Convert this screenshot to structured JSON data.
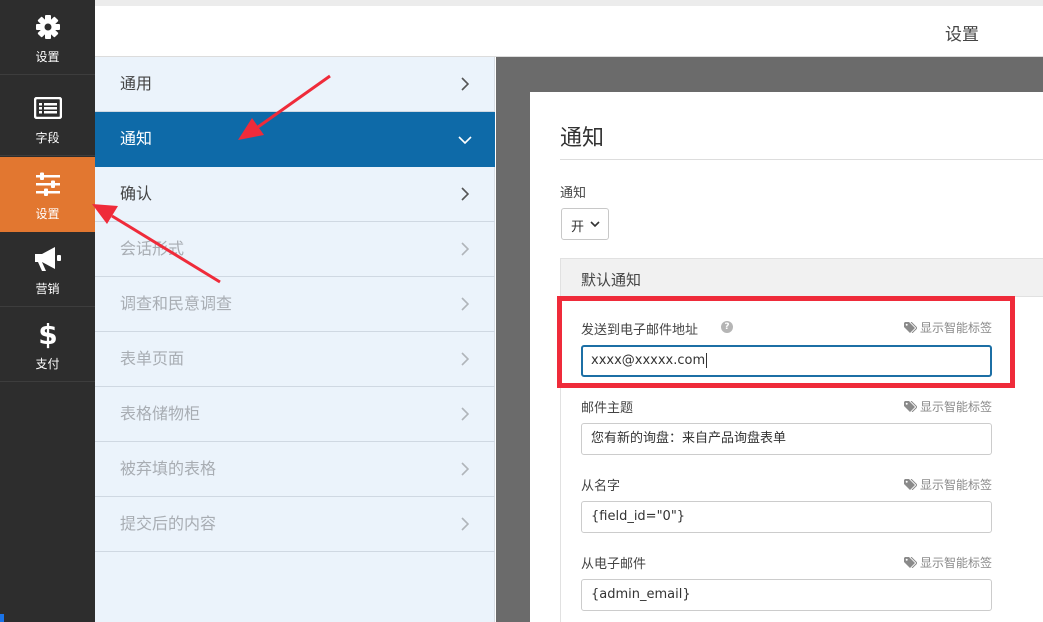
{
  "rail": {
    "items": [
      {
        "label": "设置",
        "icon": "gear-icon",
        "active": false
      },
      {
        "label": "字段",
        "icon": "list-icon",
        "active": false
      },
      {
        "label": "设置",
        "icon": "sliders-icon",
        "active": true
      },
      {
        "label": "营销",
        "icon": "megaphone-icon",
        "active": false
      },
      {
        "label": "支付",
        "icon": "dollar-icon",
        "active": false
      }
    ]
  },
  "header": {
    "title": "设置"
  },
  "menu": {
    "items": [
      {
        "label": "通用",
        "state": "normal"
      },
      {
        "label": "通知",
        "state": "active"
      },
      {
        "label": "确认",
        "state": "normal"
      },
      {
        "label": "会话形式",
        "state": "disabled"
      },
      {
        "label": "调查和民意调查",
        "state": "disabled"
      },
      {
        "label": "表单页面",
        "state": "disabled"
      },
      {
        "label": "表格储物柜",
        "state": "disabled"
      },
      {
        "label": "被弃填的表格",
        "state": "disabled"
      },
      {
        "label": "提交后的内容",
        "state": "disabled"
      }
    ]
  },
  "panel": {
    "title": "通知",
    "notifications_label": "通知",
    "notifications_value": "开",
    "section_title": "默认通知",
    "smart_tag_label": "显示智能标签",
    "fields": [
      {
        "label": "发送到电子邮件地址",
        "value": "xxxx@xxxxx.com",
        "help": true,
        "focused": true
      },
      {
        "label": "邮件主题",
        "value": "您有新的询盘：来自产品询盘表单",
        "help": false,
        "focused": false
      },
      {
        "label": "从名字",
        "value": "{field_id=\"0\"}",
        "help": false,
        "focused": false
      },
      {
        "label": "从电子邮件",
        "value": "{admin_email}",
        "help": false,
        "focused": false
      }
    ]
  },
  "colors": {
    "rail_bg": "#2d2d2d",
    "rail_active": "#e27730",
    "menu_bg": "#ebf3fb",
    "menu_active": "#0e6aa8",
    "annotation": "#ef2b3a"
  }
}
